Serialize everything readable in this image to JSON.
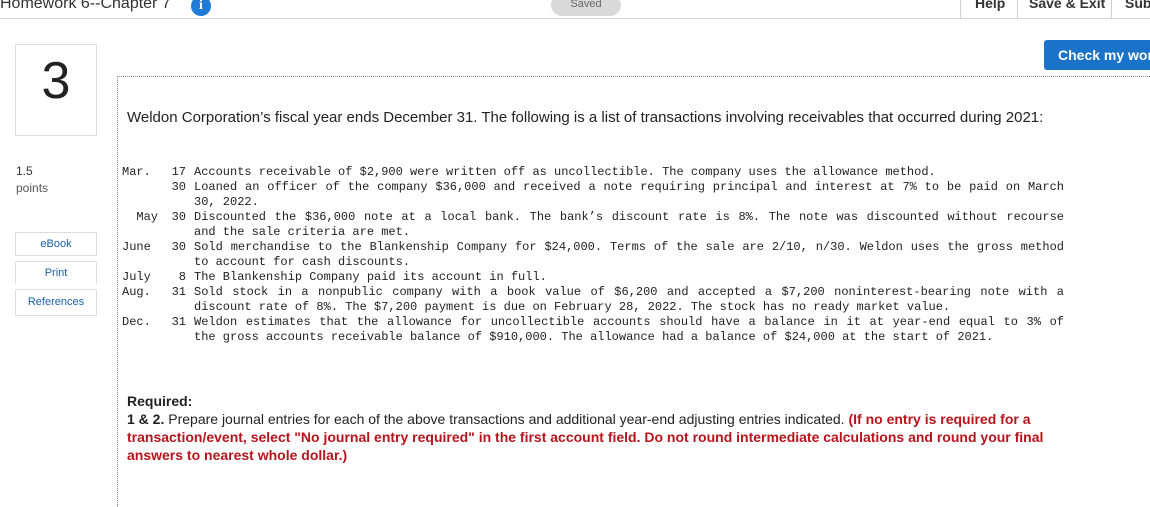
{
  "header": {
    "title": "Homework 6--Chapter 7",
    "info_icon": "info-icon",
    "saved_label": "Saved",
    "help_label": "Help",
    "save_exit_label": "Save & Exit",
    "submit_label": "Sub"
  },
  "question": {
    "number": "3",
    "points_value": "1.5",
    "points_label": "points"
  },
  "side_buttons": {
    "ebook": "eBook",
    "print": "Print",
    "references": "References"
  },
  "check_button": "Check my wor",
  "intro": "Weldon Corporation’s fiscal year ends December 31. The following is a list of transactions involving receivables that occurred during 2021:",
  "transactions": [
    {
      "month": "Mar.",
      "day": "17",
      "text": "Accounts receivable of $2,900 were written off as uncollectible. The company uses the allowance method."
    },
    {
      "month": "",
      "day": "30",
      "text": "Loaned an officer of the company $36,000 and received a note requiring principal and interest at 7% to be paid on March 30, 2022."
    },
    {
      "month": "May",
      "day": "30",
      "text": "Discounted the $36,000 note at a local bank. The bank’s discount rate is 8%. The note was discounted without recourse and the sale criteria are met."
    },
    {
      "month": "June",
      "day": "30",
      "text": "Sold merchandise to the Blankenship Company for $24,000. Terms of the sale are 2/10, n/30. Weldon uses the gross method to account for cash discounts."
    },
    {
      "month": "July",
      "day": "8",
      "text": "The Blankenship Company paid its account in full."
    },
    {
      "month": "Aug.",
      "day": "31",
      "text": "Sold stock in a nonpublic company with a book value of $6,200 and accepted a $7,200 noninterest-bearing note with a discount rate of 8%. The $7,200 payment is due on February 28, 2022. The stock has no ready market value."
    },
    {
      "month": "Dec.",
      "day": "31",
      "text": "Weldon estimates that the allowance for uncollectible accounts should have a balance in it at year-end equal to 3% of the gross accounts receivable balance of $910,000. The allowance had a balance of $24,000 at the start of 2021."
    }
  ],
  "required": {
    "title": "Required:",
    "number": "1 & 2.",
    "text": "Prepare journal entries for each of the above transactions and additional year-end adjusting entries indicated.",
    "note": "(If no entry is required for a transaction/event, select \"No journal entry required\" in the first account field. Do not round intermediate calculations and round your final answers to nearest whole dollar.)"
  },
  "colors": {
    "accent": "#1a73c9",
    "info_icon": "#1f7bd6",
    "note_red": "#b7141b",
    "link": "#1a5fa8"
  }
}
